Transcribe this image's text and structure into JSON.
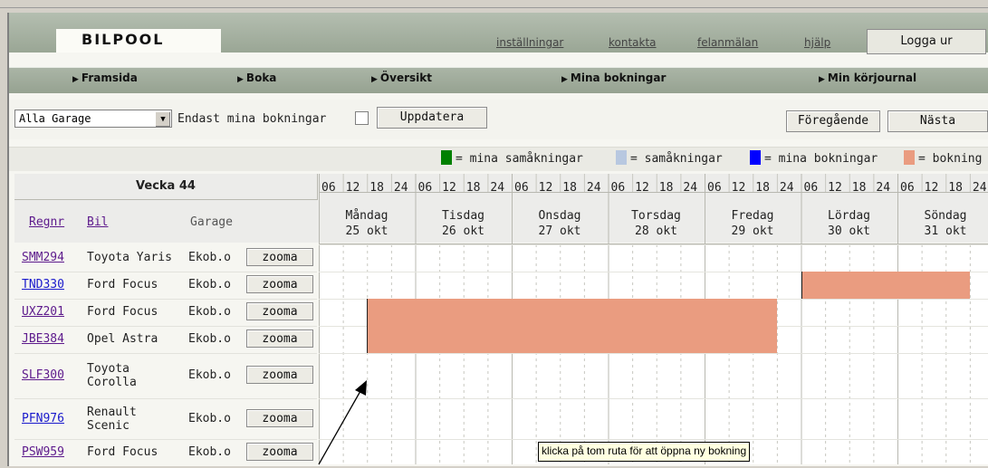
{
  "app": {
    "logo": "BILPOOL",
    "top_links": [
      "inställningar",
      "kontakta",
      "felanmälan",
      "hjälp"
    ],
    "logout_label": "Logga ur"
  },
  "nav": {
    "items": [
      "Framsida",
      "Boka",
      "Översikt",
      "Mina bokningar",
      "Min körjournal"
    ]
  },
  "toolbar": {
    "garage_select_value": "Alla Garage",
    "only_mine_label": "Endast mina bokningar",
    "only_mine_checked": false,
    "update_label": "Uppdatera",
    "prev_label": "Föregående",
    "next_label": "Nästa"
  },
  "legend": {
    "items": [
      {
        "label": "= mina samåkningar",
        "color": "#008000"
      },
      {
        "label": "= samåkningar",
        "color": "#b8c8e0"
      },
      {
        "label": "= mina bokningar",
        "color": "#0000ff"
      },
      {
        "label": "= bokning",
        "color": "#ea9c80"
      }
    ]
  },
  "schedule": {
    "week_label": "Vecka 44",
    "columns": {
      "regnr": "Regnr",
      "bil": "Bil",
      "garage": "Garage"
    },
    "hours": [
      "06",
      "12",
      "18",
      "24"
    ],
    "days": [
      {
        "name": "Måndag",
        "date": "25 okt"
      },
      {
        "name": "Tisdag",
        "date": "26 okt"
      },
      {
        "name": "Onsdag",
        "date": "27 okt"
      },
      {
        "name": "Torsdag",
        "date": "28 okt"
      },
      {
        "name": "Fredag",
        "date": "29 okt"
      },
      {
        "name": "Lördag",
        "date": "30 okt"
      },
      {
        "name": "Söndag",
        "date": "31 okt"
      }
    ],
    "zoom_label": "zooma",
    "rows": [
      {
        "regnr": "SMM294",
        "bil": "Toyota Yaris",
        "garage": "Ekob.o",
        "visited": true
      },
      {
        "regnr": "TND330",
        "bil": "Ford Focus",
        "garage": "Ekob.o",
        "visited": false
      },
      {
        "regnr": "UXZ201",
        "bil": "Ford Focus",
        "garage": "Ekob.o",
        "visited": true
      },
      {
        "regnr": "JBE384",
        "bil": "Opel Astra",
        "garage": "Ekob.o",
        "visited": true
      },
      {
        "regnr": "SLF300",
        "bil": "Toyota Corolla",
        "garage": "Ekob.o",
        "visited": true
      },
      {
        "regnr": "PFN976",
        "bil": "Renault Scenic",
        "garage": "Ekob.o",
        "visited": false
      },
      {
        "regnr": "PSW959",
        "bil": "Ford Focus",
        "garage": "Ekob.o",
        "visited": true
      }
    ],
    "bookings": [
      {
        "regnr": "TND330",
        "from": "Fredag 24:00",
        "to": "Söndag 18:00"
      },
      {
        "regnr": "UXZ201",
        "from": "Måndag 12:00",
        "to": "Fredag 18:00"
      },
      {
        "regnr": "JBE384",
        "from": "Måndag 12:00",
        "to": "Fredag 18:00"
      }
    ],
    "tooltip": "klicka på tom ruta för att öppna ny bokning"
  }
}
